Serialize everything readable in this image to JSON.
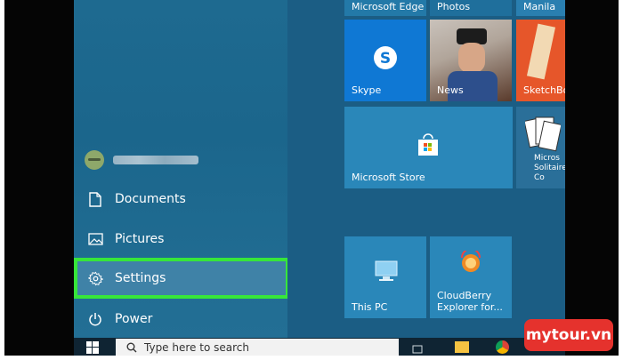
{
  "start_menu": {
    "user": {
      "name": ""
    },
    "items": [
      {
        "label": "Documents",
        "icon": "document-icon"
      },
      {
        "label": "Pictures",
        "icon": "pictures-icon"
      },
      {
        "label": "Settings",
        "icon": "gear-icon"
      },
      {
        "label": "Power",
        "icon": "power-icon"
      }
    ],
    "highlight_color": "#37e63a"
  },
  "tiles": {
    "top_row": [
      "Microsoft Edge",
      "Photos",
      "Manila"
    ],
    "skype": "Skype",
    "news": "News",
    "sketchbook": "SketchBo",
    "store": "Microsoft Store",
    "solitaire": "Micros Solitaire Co",
    "this_pc": "This PC",
    "cloudberry": "CloudBerry Explorer for..."
  },
  "taskbar": {
    "search_placeholder": "Type here to search"
  },
  "watermark": "mytour.vn"
}
